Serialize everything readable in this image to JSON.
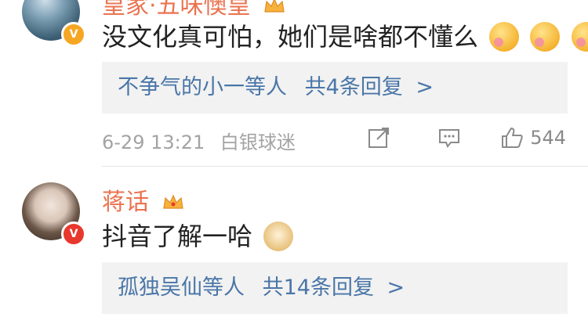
{
  "comments": [
    {
      "username": "皇家·五味懊皇",
      "text": "没文化真可怕，她们是啥都不懂么",
      "emojis": [
        "yum-face",
        "yum-face",
        "yum-face"
      ],
      "replies": {
        "names": "不争气的小一",
        "suffix": "等人",
        "count_text": "共4条回复",
        "arrow": ">"
      },
      "time": "6-29 13:21",
      "source": "白银球迷",
      "like_count": "544"
    },
    {
      "username": "蒋话",
      "text": "抖音了解一哈",
      "emojis": [
        "doge-face"
      ],
      "replies": {
        "names": "孤独吴仙",
        "suffix": "等人",
        "count_text": "共14条回复",
        "arrow": ">"
      }
    }
  ],
  "colors": {
    "username": "#eb7350",
    "reply_link": "#4a76a8",
    "meta_gray": "#a3a3a3",
    "reply_bg": "#f2f2f2"
  }
}
